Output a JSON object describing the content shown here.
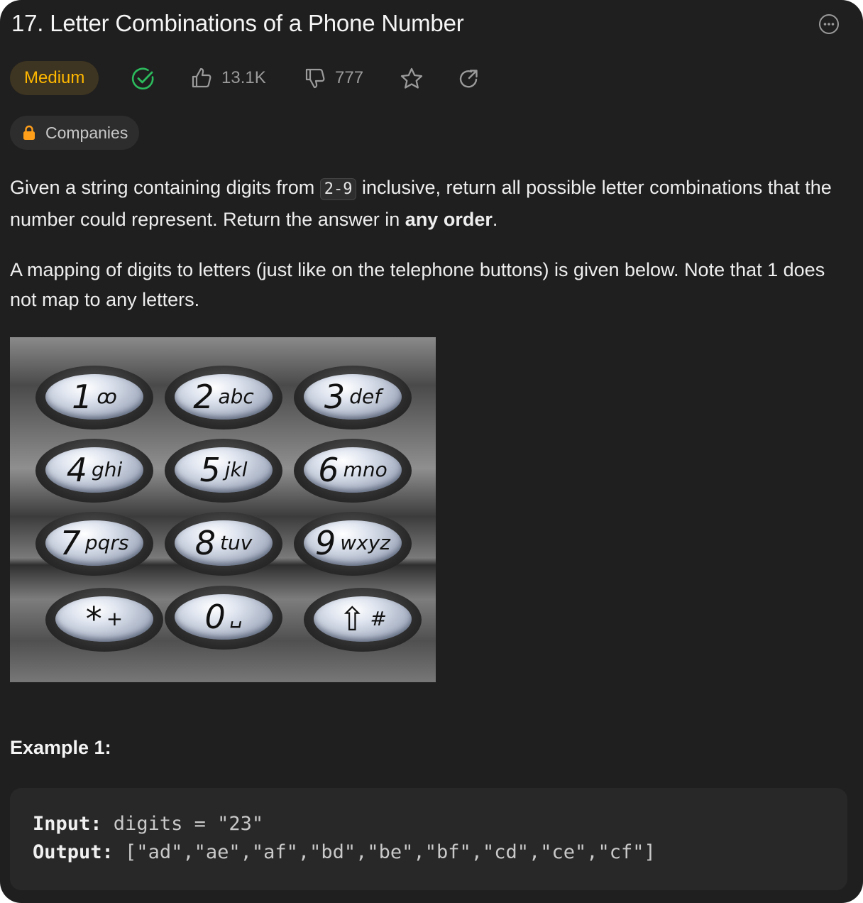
{
  "problem": {
    "title": "17. Letter Combinations of a Phone Number",
    "difficulty": "Medium",
    "likes": "13.1K",
    "dislikes": "777",
    "companies_label": "Companies"
  },
  "description": {
    "p1_before": "Given a string containing digits from ",
    "p1_code": "2-9",
    "p1_middle": " inclusive, return all possible letter combinations that the number could represent. Return the answer in ",
    "p1_bold": "any order",
    "p1_end": ".",
    "p2": "A mapping of digits to letters (just like on the telephone buttons) is given below. Note that 1 does not map to any letters."
  },
  "keypad": {
    "keys": [
      {
        "digit": "1",
        "letters": "ꝏ"
      },
      {
        "digit": "2",
        "letters": "abc"
      },
      {
        "digit": "3",
        "letters": "def"
      },
      {
        "digit": "4",
        "letters": "ghi"
      },
      {
        "digit": "5",
        "letters": "jkl"
      },
      {
        "digit": "6",
        "letters": "mno"
      },
      {
        "digit": "7",
        "letters": "pqrs"
      },
      {
        "digit": "8",
        "letters": "tuv"
      },
      {
        "digit": "9",
        "letters": "wxyz"
      },
      {
        "digit": "*",
        "letters": "+"
      },
      {
        "digit": "0",
        "letters": "␣"
      },
      {
        "digit": "⇧",
        "letters": "#"
      }
    ]
  },
  "example1": {
    "title": "Example 1:",
    "input_label": "Input:",
    "input_value": " digits = \"23\"",
    "output_label": "Output:",
    "output_value": " [\"ad\",\"ae\",\"af\",\"bd\",\"be\",\"bf\",\"cd\",\"ce\",\"cf\"]"
  },
  "colors": {
    "difficulty_text": "#ffb800",
    "difficulty_bg": "#3d3421",
    "solved_check": "#2cbb5d",
    "panel_bg": "#1f1f1f"
  },
  "icons": [
    "more-icon",
    "solved-check-icon",
    "thumbs-up-icon",
    "thumbs-down-icon",
    "star-icon",
    "share-icon",
    "lock-icon"
  ]
}
